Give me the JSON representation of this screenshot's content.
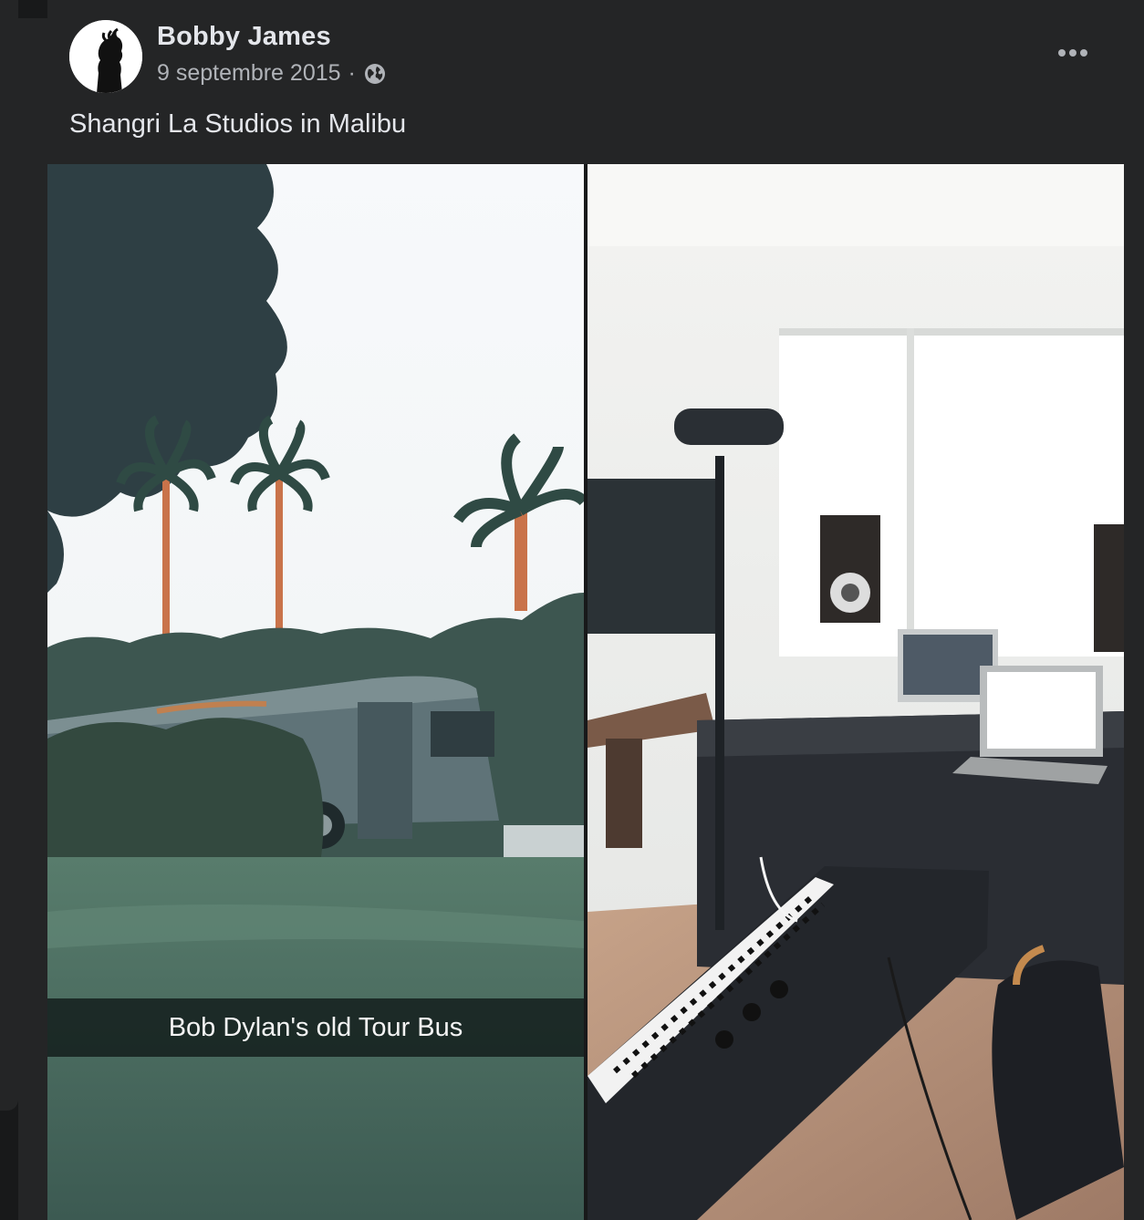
{
  "post": {
    "author": "Bobby James",
    "date": "9 septembre 2015",
    "separator": "·",
    "audience_icon": "globe-icon",
    "more_icon": "more-dots-icon",
    "caption": "Shangri La Studios in Malibu"
  },
  "photos": [
    {
      "overlay_text": "Bob Dylan's old Tour Bus"
    },
    {
      "overlay_text": ""
    }
  ],
  "colors": {
    "background": "#18191a",
    "card": "#242526",
    "primary_text": "#e4e6eb",
    "secondary_text": "#b0b3b8"
  }
}
